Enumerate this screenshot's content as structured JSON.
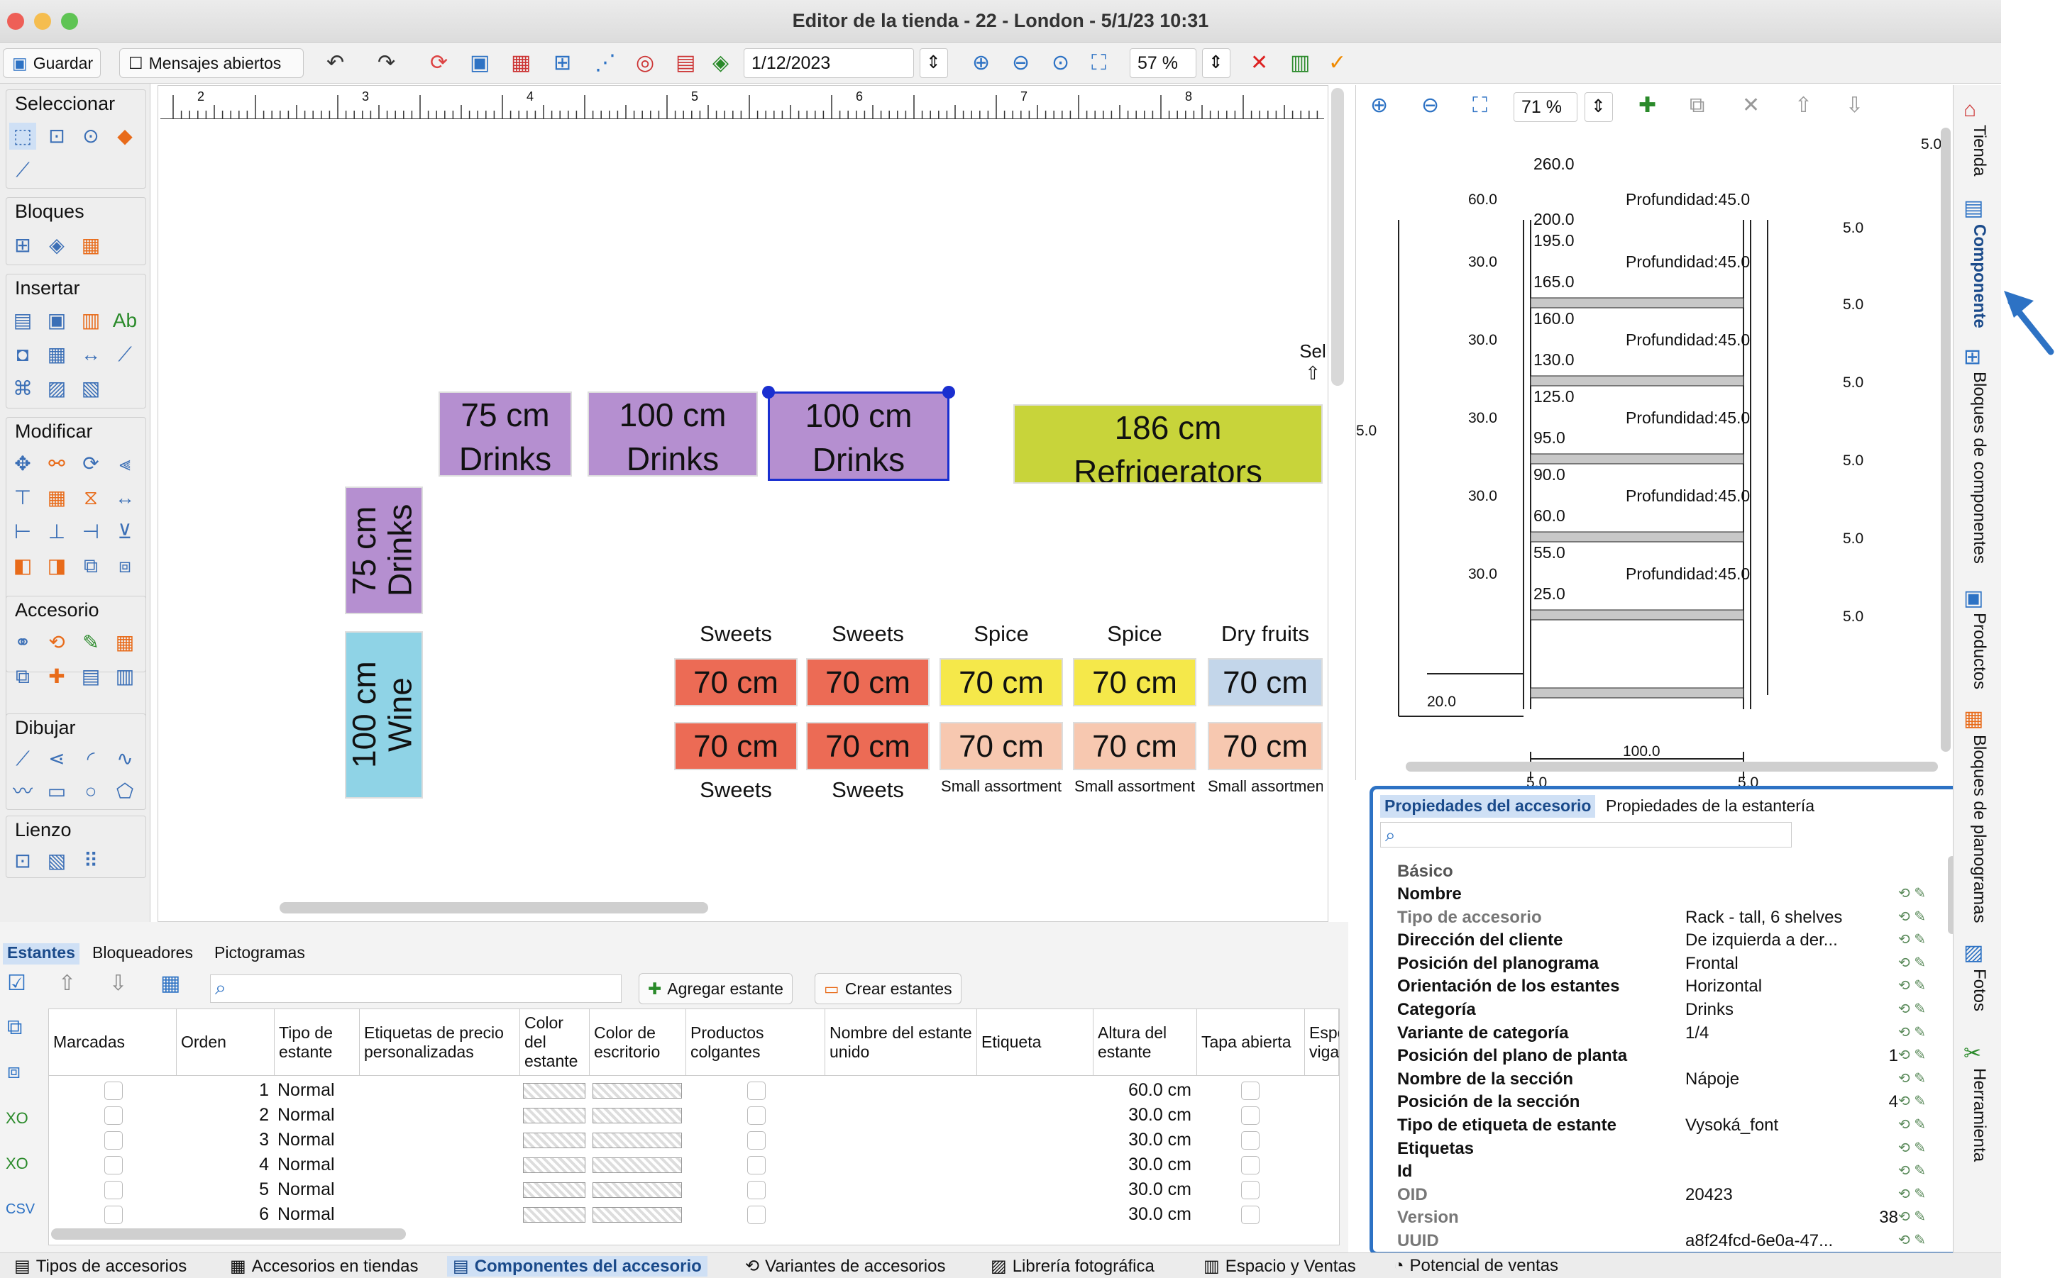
{
  "window": {
    "title": "Editor de la tienda - 22 - London - 5/1/23 10:31"
  },
  "toolbar": {
    "save": "Guardar",
    "messages": "Mensajes abiertos",
    "date": "1/12/2023",
    "zoom": "57 %"
  },
  "palette": {
    "sections": [
      "Seleccionar",
      "Bloques",
      "Insertar",
      "Modificar",
      "Accesorio",
      "Dibujar",
      "Lienzo"
    ]
  },
  "ruler": {
    "ticks": [
      "2",
      "3",
      "4",
      "5",
      "6",
      "7",
      "8"
    ]
  },
  "canvas": {
    "sel_label": "Sel",
    "fixtures": [
      {
        "size": "75 cm",
        "name": "Drinks"
      },
      {
        "size": "100 cm",
        "name": "Drinks"
      },
      {
        "size": "100 cm",
        "name": "Drinks"
      },
      {
        "size": "186 cm",
        "name": "Refrigerators"
      },
      {
        "size": "75 cm",
        "name": "Drinks"
      },
      {
        "size": "100 cm",
        "name": "Wine"
      }
    ],
    "top_labels": [
      "Sweets",
      "Sweets",
      "Spice",
      "Spice",
      "Dry fruits"
    ],
    "row1": [
      "70 cm",
      "70 cm",
      "70 cm",
      "70 cm",
      "70 cm"
    ],
    "row2": [
      "70 cm",
      "70 cm",
      "70 cm",
      "70 cm",
      "70 cm"
    ],
    "bottom_labels": [
      "Sweets",
      "Sweets",
      "Small assortment",
      "Small assortment",
      "Small assortmen"
    ],
    "colors": {
      "drinks": "#b58fd0",
      "refrigerators": "#c8d43a",
      "wine": "#8fd3e6",
      "sweets": "#ec6b55",
      "spice": "#f5e84a",
      "dry": "#c3d6ea",
      "small": "#f7c8b0"
    }
  },
  "component": {
    "zoom": "71 %",
    "heights": [
      "60.0",
      "30.0",
      "30.0",
      "30.0",
      "30.0",
      "30.0"
    ],
    "levels": [
      [
        "260.0",
        "200.0"
      ],
      [
        "195.0",
        "165.0"
      ],
      [
        "160.0",
        "130.0"
      ],
      [
        "125.0",
        "95.0"
      ],
      [
        "90.0",
        "60.0"
      ],
      [
        "55.0",
        "25.0"
      ]
    ],
    "depth": "Profundidad:45.0",
    "side": [
      "5.0",
      "5.0",
      "5.0",
      "5.0",
      "5.0",
      "5.0"
    ],
    "top_right": "5.0",
    "left_edge": "5.0",
    "base": "20.0",
    "width": "100.0",
    "foot_left": "5.0",
    "foot_right": "5.0"
  },
  "properties": {
    "tabs": [
      "Propiedades del accesorio",
      "Propiedades de la estantería"
    ],
    "group": "Básico",
    "rows": [
      {
        "k": "Nombre",
        "v": "",
        "g": false
      },
      {
        "k": "Tipo de accesorio",
        "v": "Rack - tall, 6 shelves",
        "g": true
      },
      {
        "k": "Dirección del cliente",
        "v": "De izquierda a der...",
        "g": false
      },
      {
        "k": "Posición del planograma",
        "v": "Frontal",
        "g": false
      },
      {
        "k": "Orientación de los estantes",
        "v": "Horizontal",
        "g": false
      },
      {
        "k": "Categoría",
        "v": "Drinks",
        "g": false
      },
      {
        "k": "Variante de categoría",
        "v": "1/4",
        "g": false
      },
      {
        "k": "Posición del plano de planta",
        "v": "1",
        "g": false
      },
      {
        "k": "Nombre de la sección",
        "v": "Nápoje",
        "g": false
      },
      {
        "k": "Posición de la sección",
        "v": "4",
        "g": false
      },
      {
        "k": "Tipo de etiqueta de estante",
        "v": "Vysoká_font",
        "g": false
      },
      {
        "k": "Etiquetas",
        "v": "",
        "g": false
      },
      {
        "k": "Id",
        "v": "",
        "g": false
      },
      {
        "k": "OID",
        "v": "20423",
        "g": true
      },
      {
        "k": "Version",
        "v": "38",
        "g": true
      },
      {
        "k": "UUID",
        "v": "a8f24fcd-6e0a-47...",
        "g": true
      }
    ]
  },
  "shelves": {
    "tabs": [
      "Estantes",
      "Bloqueadores",
      "Pictogramas"
    ],
    "add": "Agregar estante",
    "create": "Crear estantes",
    "headers": [
      "Marcadas",
      "Orden",
      "Tipo de estante",
      "Etiquetas de precio personalizadas",
      "Color del estante",
      "Color de escritorio",
      "Productos colgantes",
      "Nombre del estante unido",
      "Etiqueta",
      "Altura del estante",
      "Tapa abierta",
      "Espe viga"
    ],
    "rows": [
      {
        "order": "1",
        "type": "Normal",
        "height": "60.0 cm"
      },
      {
        "order": "2",
        "type": "Normal",
        "height": "30.0 cm"
      },
      {
        "order": "3",
        "type": "Normal",
        "height": "30.0 cm"
      },
      {
        "order": "4",
        "type": "Normal",
        "height": "30.0 cm"
      },
      {
        "order": "5",
        "type": "Normal",
        "height": "30.0 cm"
      },
      {
        "order": "6",
        "type": "Normal",
        "height": "30.0 cm"
      }
    ]
  },
  "sidetabs": [
    "Tienda",
    "Componente",
    "Bloques de componentes",
    "Productos",
    "Bloques de planogramas",
    "Fotos",
    "Herramienta"
  ],
  "status": [
    "Tipos de accesorios",
    "Accesorios en tiendas",
    "Componentes del accesorio",
    "Variantes de accesorios",
    "Librería fotográfica",
    "Espacio y Ventas",
    "Potencial de ventas"
  ]
}
